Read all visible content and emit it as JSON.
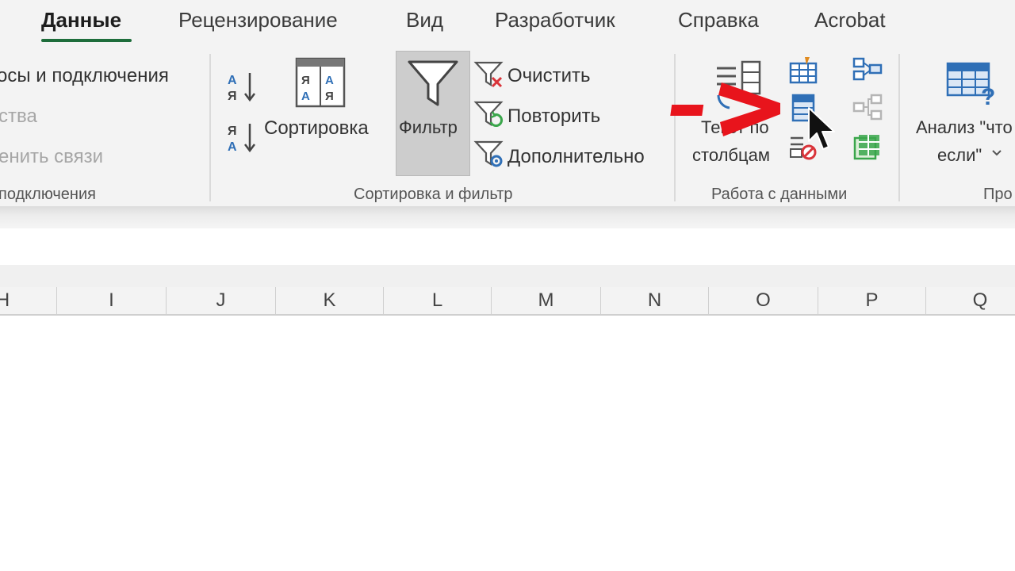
{
  "tabs": [
    {
      "label": "Данные",
      "active": true
    },
    {
      "label": "Рецензирование"
    },
    {
      "label": "Вид"
    },
    {
      "label": "Разработчик"
    },
    {
      "label": "Справка"
    },
    {
      "label": "Acrobat"
    }
  ],
  "ribbon": {
    "connections": {
      "item1": "осы и подключения",
      "item2": "ства",
      "item3": "енить связи",
      "group_label": "подключения"
    },
    "sort_filter": {
      "sort_label": "Сортировка",
      "filter_label": "Фильтр",
      "clear_label": "Очистить",
      "reapply_label": "Повторить",
      "advanced_label": "Дополнительно",
      "group_label": "Сортировка и фильтр"
    },
    "data_tools": {
      "text_to_columns_line1": "Текст по",
      "text_to_columns_line2": "столбцам",
      "group_label": "Работа с данными"
    },
    "forecast": {
      "whatif_line1": "Анализ \"что",
      "whatif_line2": "если\"",
      "group_label": "Про"
    }
  },
  "columns": [
    "H",
    "I",
    "J",
    "K",
    "L",
    "M",
    "N",
    "O",
    "P",
    "Q"
  ],
  "colors": {
    "accent_green": "#1e6d3b",
    "annotation_red": "#e8141c",
    "icon_blue": "#2f6fb6",
    "icon_red": "#d9343a",
    "icon_green": "#3aa64b"
  }
}
